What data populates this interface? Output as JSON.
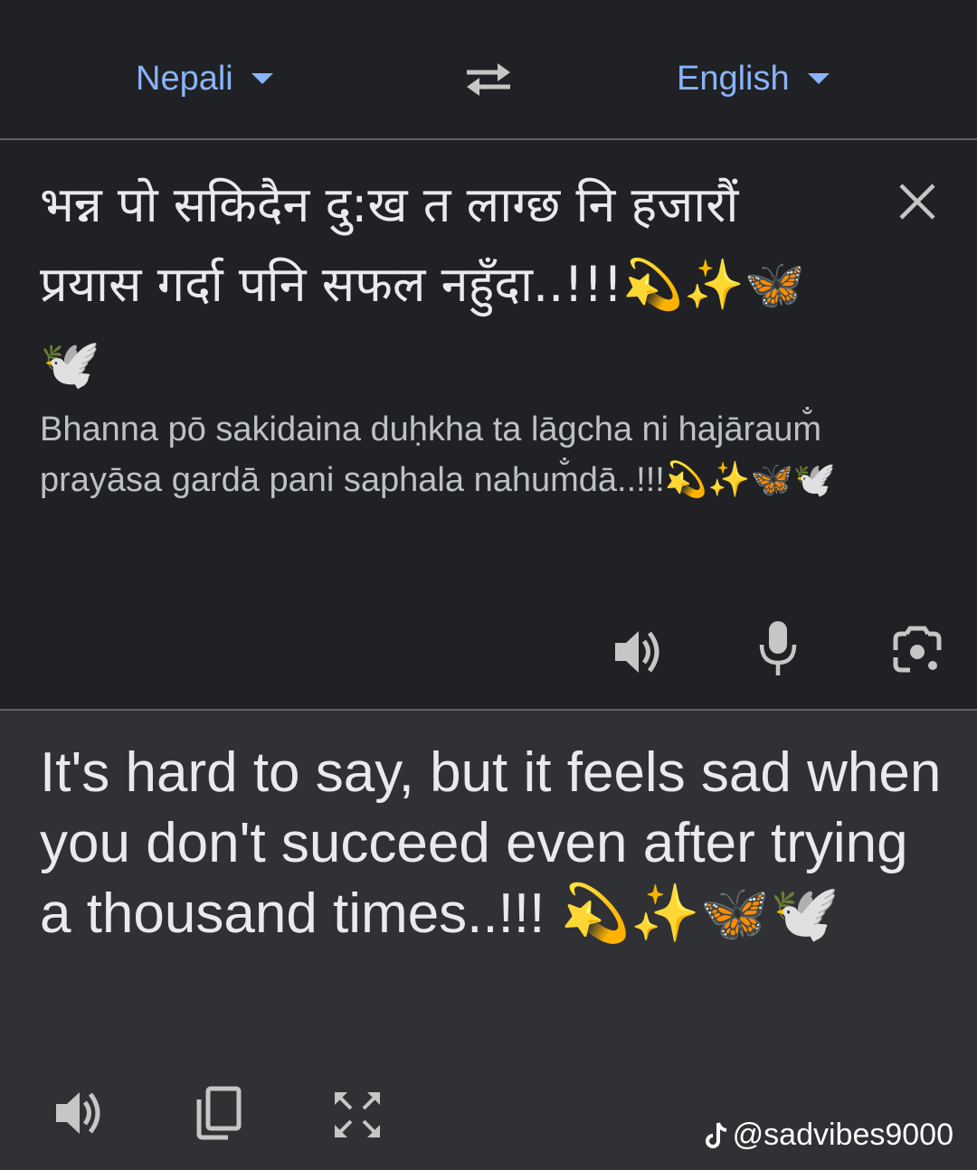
{
  "header": {
    "source_language": "Nepali",
    "target_language": "English",
    "swap_icon": "swap-arrows-icon"
  },
  "source": {
    "text": "भन्न पो सकिदैन दु:ख त लाग्छ नि हजारौं प्रयास गर्दा पनि सफल नहुँदा..!!!💫✨🦋🕊️",
    "transliteration": "Bhanna pō sakidaina duḥkha ta lāgcha ni hajāraum̐ prayāsa gardā pani saphala nahum̐dā..!!!💫✨🦋🕊️",
    "icons": [
      "close-icon",
      "speaker-icon",
      "microphone-icon",
      "camera-lens-icon"
    ]
  },
  "target": {
    "text": "It's hard to say, but it feels sad when you don't succeed even after trying a thousand times..!!! 💫✨🦋🕊️",
    "icons": [
      "speaker-icon",
      "copy-icon",
      "fullscreen-icon"
    ]
  },
  "watermark": {
    "handle": "@sadvibes9000"
  },
  "colors": {
    "background": "#202124",
    "target_background": "#303134",
    "accent": "#8ab4f8",
    "text": "#e8eaed",
    "icon": "#c4c7c5"
  }
}
